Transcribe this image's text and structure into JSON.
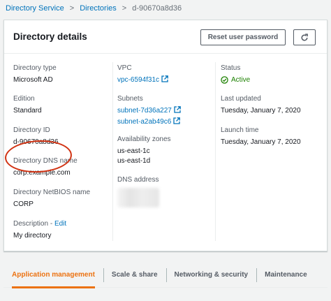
{
  "breadcrumb": {
    "items": [
      "Directory Service",
      "Directories"
    ],
    "current": "d-90670a8d36",
    "separator": ">"
  },
  "panel": {
    "title": "Directory details",
    "reset_button": "Reset user password",
    "refresh_icon": "refresh-icon"
  },
  "col1": {
    "directory_type_label": "Directory type",
    "directory_type_value": "Microsoft AD",
    "edition_label": "Edition",
    "edition_value": "Standard",
    "directory_id_label": "Directory ID",
    "directory_id_value": "d-90670a8d36",
    "dns_name_label": "Directory DNS name",
    "dns_name_value": "corp.example.com",
    "netbios_label": "Directory NetBIOS name",
    "netbios_value": "CORP",
    "description_label": "Description",
    "description_sep": "-",
    "edit_link": "Edit",
    "description_value": "My directory"
  },
  "col2": {
    "vpc_label": "VPC",
    "vpc_value": "vpc-6594f31c",
    "subnets_label": "Subnets",
    "subnets": [
      "subnet-7d36a227",
      "subnet-a2ab49c6"
    ],
    "az_label": "Availability zones",
    "az_values": [
      "us-east-1c",
      "us-east-1d"
    ],
    "dns_address_label": "DNS address"
  },
  "col3": {
    "status_label": "Status",
    "status_value": "Active",
    "last_updated_label": "Last updated",
    "last_updated_value": "Tuesday, January 7, 2020",
    "launch_time_label": "Launch time",
    "launch_time_value": "Tuesday, January 7, 2020"
  },
  "tabs": [
    "Application management",
    "Scale & share",
    "Networking & security",
    "Maintenance"
  ],
  "colors": {
    "link": "#0073bb",
    "active_tab": "#ec7211",
    "status_ok": "#1d8102",
    "highlight": "#d13212"
  }
}
